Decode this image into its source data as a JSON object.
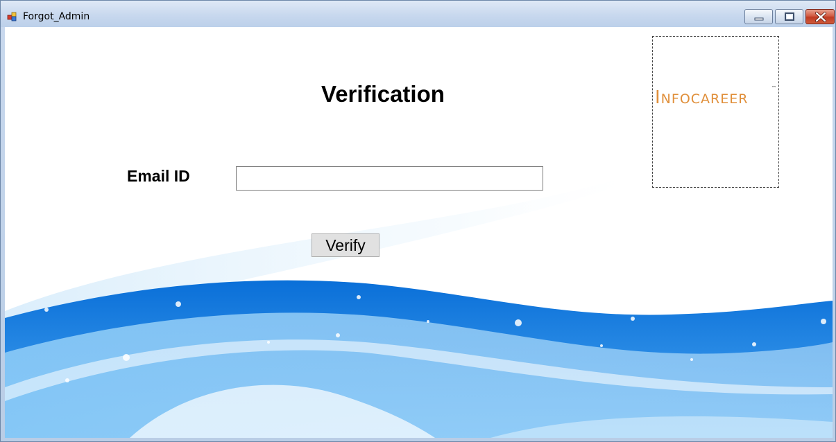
{
  "window": {
    "title": "Forgot_Admin"
  },
  "form": {
    "heading": "Verification",
    "email_label": "Email ID",
    "email_value": "",
    "verify_label": "Verify"
  },
  "logo": {
    "text_first": "I",
    "text_rest": "NFOCAREER",
    "trademark": "™",
    "color": "#e08f3a"
  },
  "icons": {
    "app": "app-icon",
    "minimize": "minimize-icon",
    "maximize": "maximize-icon",
    "close": "close-icon"
  },
  "colors": {
    "wave_dark": "#0a6fd8",
    "wave_light": "#7ec4f6",
    "close_button": "#c03a22"
  }
}
